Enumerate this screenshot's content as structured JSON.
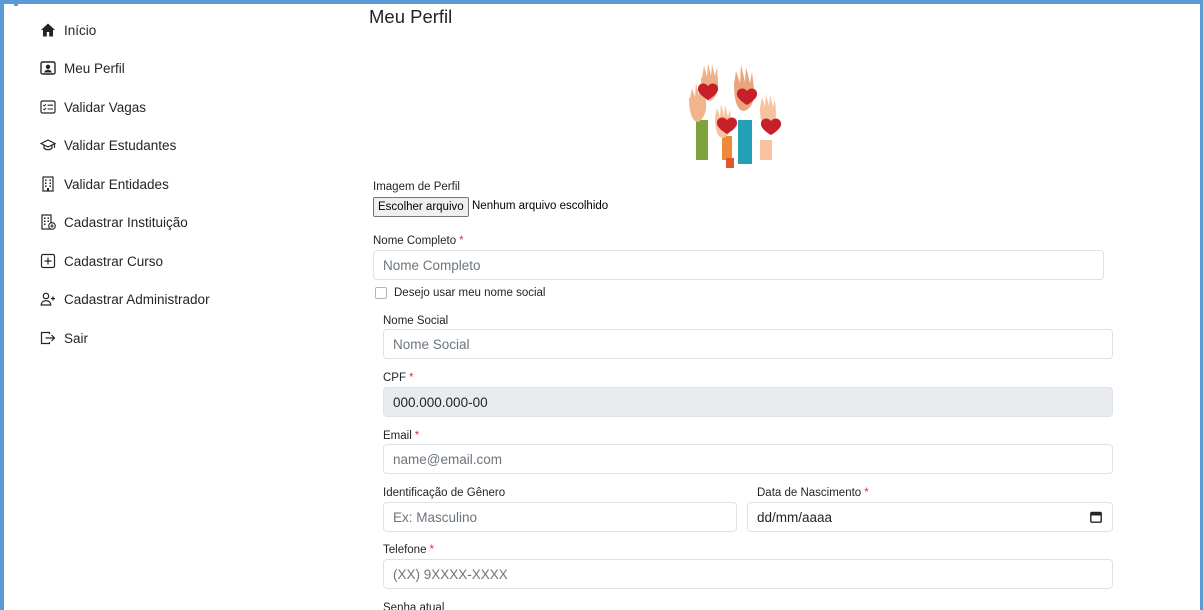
{
  "sidebar": {
    "items": [
      {
        "label": "Início",
        "icon": "house-icon"
      },
      {
        "label": "Meu Perfil",
        "icon": "person-badge-icon"
      },
      {
        "label": "Validar Vagas",
        "icon": "checklist-icon"
      },
      {
        "label": "Validar Estudantes",
        "icon": "mortarboard-icon"
      },
      {
        "label": "Validar Entidades",
        "icon": "building-icon"
      },
      {
        "label": "Cadastrar Instituição",
        "icon": "building-add-icon"
      },
      {
        "label": "Cadastrar Curso",
        "icon": "plus-square-icon"
      },
      {
        "label": "Cadastrar Administrador",
        "icon": "person-plus-icon"
      },
      {
        "label": "Sair",
        "icon": "box-arrow-right-icon"
      }
    ]
  },
  "main": {
    "title": "Meu Perfil",
    "profile_image": {
      "label": "Imagem de Perfil",
      "button": "Escolher arquivo",
      "status": "Nenhum arquivo escolhido"
    },
    "full_name": {
      "label": "Nome Completo",
      "required": "*",
      "placeholder": "Nome Completo"
    },
    "social_name_checkbox": {
      "label": "Desejo usar meu nome social"
    },
    "social_name": {
      "label": "Nome Social",
      "placeholder": "Nome Social"
    },
    "cpf": {
      "label": "CPF",
      "required": "*",
      "value": "000.000.000-00"
    },
    "email": {
      "label": "Email",
      "required": "*",
      "placeholder": "name@email.com"
    },
    "gender": {
      "label": "Identificação de Gênero",
      "placeholder": "Ex: Masculino"
    },
    "birth_date": {
      "label": "Data de Nascimento",
      "required": "*",
      "value": "dd/mm/aaaa"
    },
    "phone": {
      "label": "Telefone",
      "required": "*",
      "placeholder": "(XX) 9XXXX-XXXX"
    },
    "current_password": {
      "label": "Senha atual"
    }
  },
  "colors": {
    "frame": "#5b9bd5",
    "required": "#dc3545",
    "input_border": "#dee2e6",
    "disabled_bg": "#e9ecef"
  }
}
